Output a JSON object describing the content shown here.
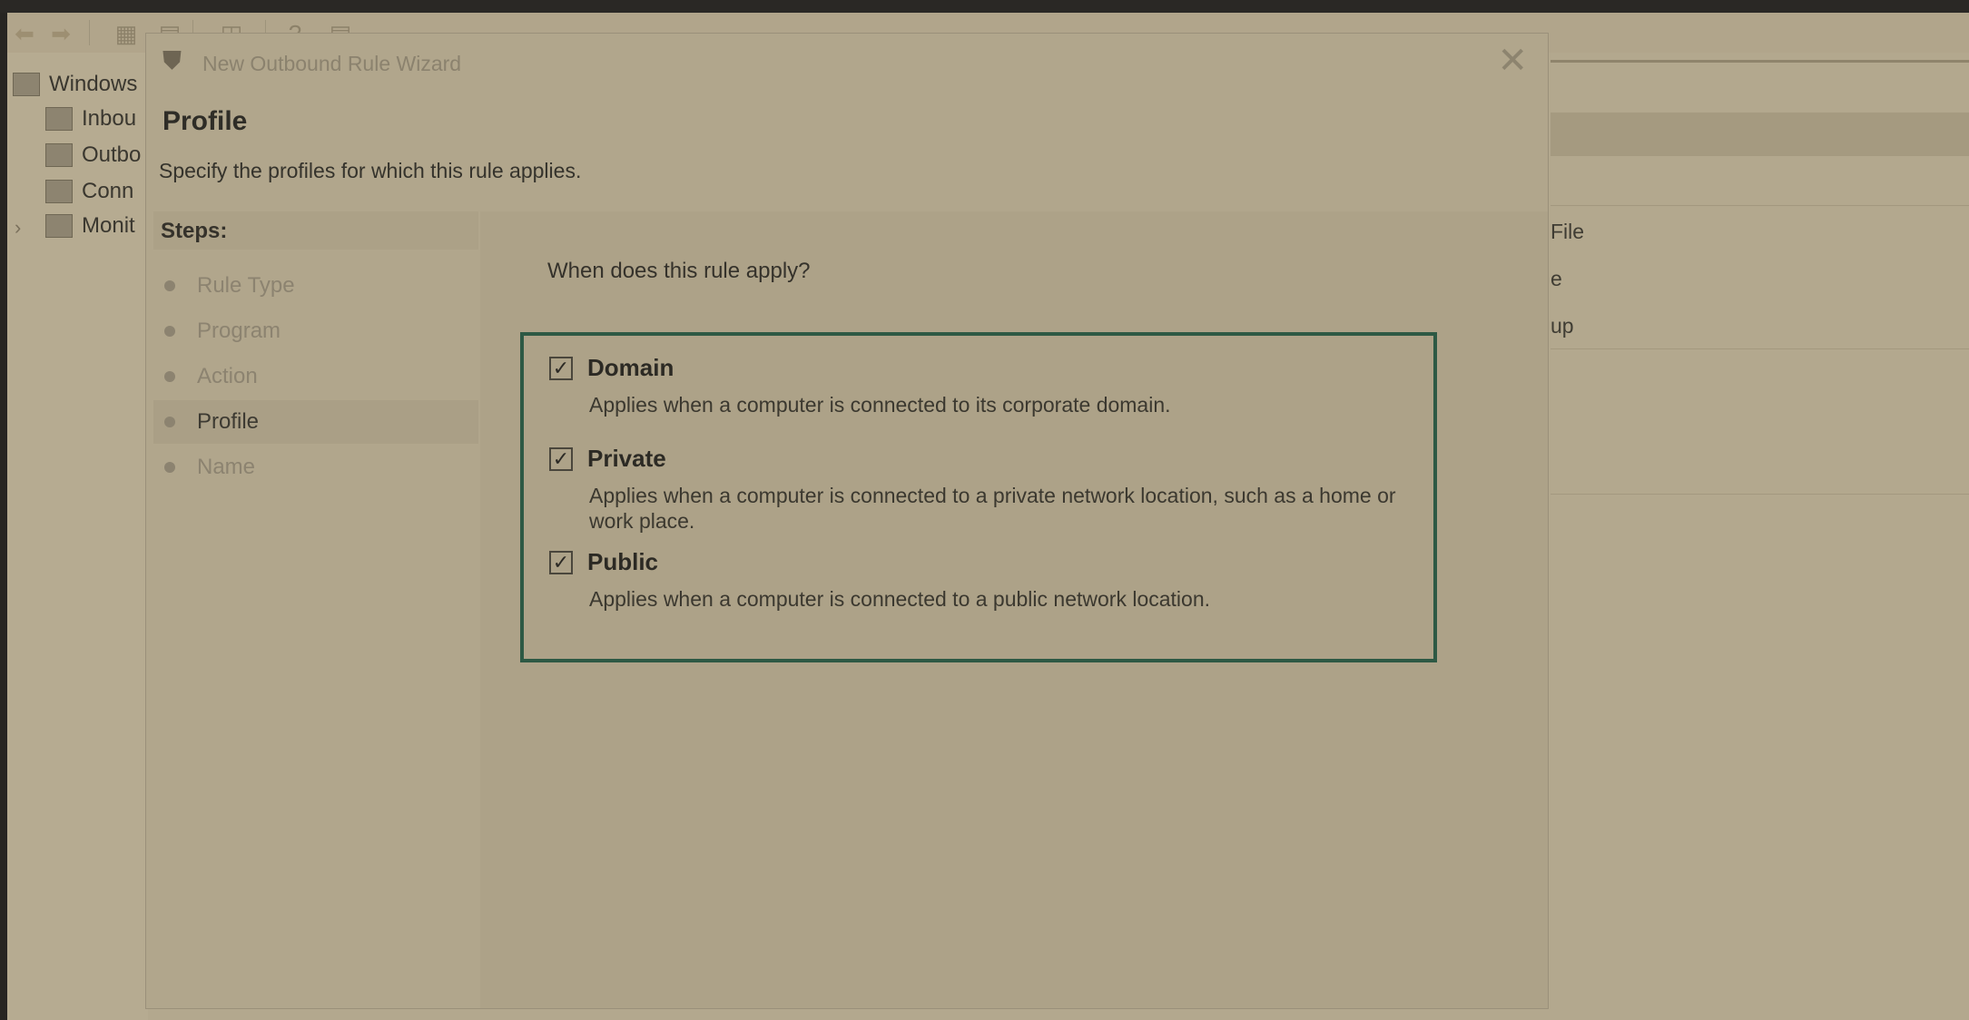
{
  "toolbar": {
    "icons": [
      "back-arrow-icon",
      "forward-arrow-icon",
      "up-folder-icon",
      "show-hide-tree-icon",
      "export-icon",
      "help-icon",
      "properties-icon"
    ]
  },
  "tree": {
    "root_label": "Windows",
    "items": [
      {
        "label": "Inbou",
        "icon": "inbound-rules-icon"
      },
      {
        "label": "Outbo",
        "icon": "outbound-rules-icon"
      },
      {
        "label": "Conn",
        "icon": "connection-security-icon"
      },
      {
        "label": "Monit",
        "icon": "monitoring-icon"
      }
    ]
  },
  "behind_panel": {
    "items": [
      "File",
      "e",
      "up"
    ]
  },
  "dialog": {
    "title": "New Outbound Rule Wizard",
    "page_title": "Profile",
    "page_desc": "Specify the profiles for which this rule applies.",
    "steps_label": "Steps:",
    "steps": [
      {
        "label": "Rule Type",
        "current": false
      },
      {
        "label": "Program",
        "current": false
      },
      {
        "label": "Action",
        "current": false
      },
      {
        "label": "Profile",
        "current": true
      },
      {
        "label": "Name",
        "current": false
      }
    ],
    "question": "When does this rule apply?",
    "options": [
      {
        "label": "Domain",
        "checked": true,
        "desc": "Applies when a computer is connected to its corporate domain."
      },
      {
        "label": "Private",
        "checked": true,
        "desc": "Applies when a computer is connected to a private network location, such as a home or work place."
      },
      {
        "label": "Public",
        "checked": true,
        "desc": "Applies when a computer is connected to a public network location."
      }
    ],
    "checkmark": "✓",
    "close_glyph": "✕"
  },
  "colors": {
    "highlight_border": "#2d5944",
    "dim_overlay_base": "#b1a68c"
  }
}
